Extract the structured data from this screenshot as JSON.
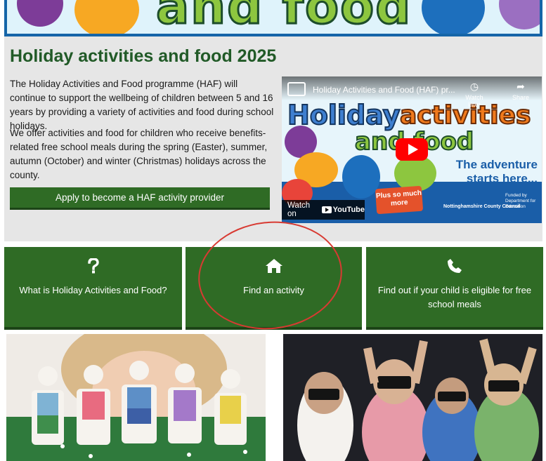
{
  "page": {
    "heading": "Holiday activities and food 2025",
    "intro_paragraphs": [
      "The Holiday Activities and Food programme (HAF) will continue to support the wellbeing of children between 5 and 16 years by providing a variety of activities and food during school holidays.",
      "We offer activities and food for children who receive benefits-related free school meals during the spring (Easter), summer, autumn (October) and winter (Christmas) holidays across the county."
    ],
    "apply_button_label": "Apply to become a HAF activity provider"
  },
  "banner": {
    "visible_text": "and food"
  },
  "video": {
    "title": "Holiday Activities and Food (HAF) pr...",
    "watch_later_label": "Watch later",
    "share_label": "Share",
    "watch_on_label": "Watch on",
    "youtube_label": "YouTube",
    "thumbnail": {
      "headline_1": "Holiday",
      "headline_2": "activities",
      "headline_3": "and food",
      "tagline": "The adventure starts here...",
      "badge": "Plus so much more",
      "council": "Nottinghamshire County Council",
      "funded_by": "Funded by",
      "department": "Department for Education"
    }
  },
  "tiles": [
    {
      "icon": "question-icon",
      "label": "What is Holiday Activities and Food?"
    },
    {
      "icon": "home-icon",
      "label": "Find an activity"
    },
    {
      "icon": "phone-icon",
      "label": "Find out if your child is eligible for free school meals"
    }
  ],
  "colors": {
    "brand_green": "#2f6b25",
    "heading_green": "#215a27",
    "highlight_circle": "#d83a32",
    "intro_background": "#e6e6e6"
  }
}
